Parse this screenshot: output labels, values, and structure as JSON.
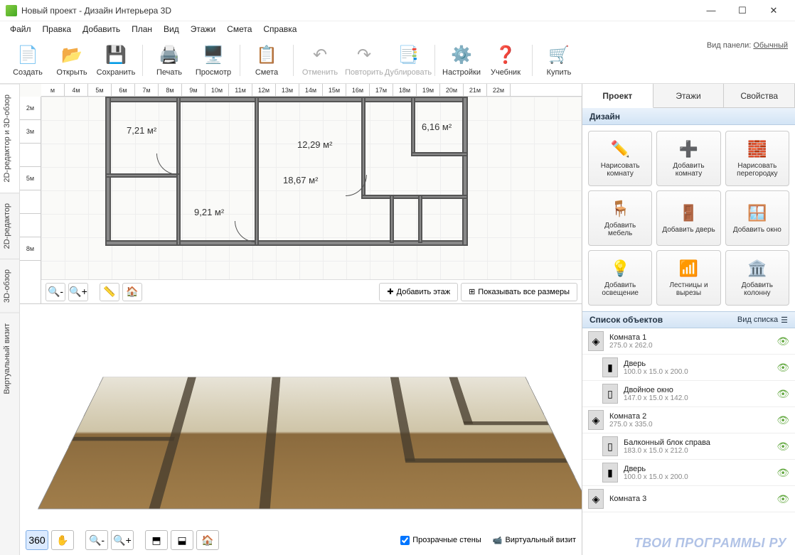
{
  "window": {
    "title": "Новый проект - Дизайн Интерьера 3D"
  },
  "menu": [
    "Файл",
    "Правка",
    "Добавить",
    "План",
    "Вид",
    "Этажи",
    "Смета",
    "Справка"
  ],
  "toolbar": {
    "create": "Создать",
    "open": "Открыть",
    "save": "Сохранить",
    "print": "Печать",
    "preview": "Просмотр",
    "estimate": "Смета",
    "undo": "Отменить",
    "redo": "Повторить",
    "duplicate": "Дублировать",
    "settings": "Настройки",
    "tutorial": "Учебник",
    "buy": "Купить",
    "panel_label": "Вид панели:",
    "panel_mode": "Обычный"
  },
  "side_tabs": {
    "t1": "2D-редактор и 3D-обзор",
    "t2": "2D-редактор",
    "t3": "3D-обзор",
    "t4": "Виртуальный визит"
  },
  "ruler_h": [
    "м",
    "4м",
    "5м",
    "6м",
    "7м",
    "8м",
    "9м",
    "10м",
    "11м",
    "12м",
    "13м",
    "14м",
    "15м",
    "16м",
    "17м",
    "18м",
    "19м",
    "20м",
    "21м",
    "22м"
  ],
  "ruler_v": [
    "2м",
    "3м",
    "",
    "5м",
    "",
    "",
    "8м"
  ],
  "rooms": {
    "r1": "7,21 м²",
    "r2": "18,67 м²",
    "r3": "12,29 м²",
    "r4": "6,16 м²",
    "r5": "9,21 м²"
  },
  "plan_actions": {
    "add_floor": "Добавить этаж",
    "show_dims": "Показывать все размеры"
  },
  "view3d": {
    "transparent": "Прозрачные стены",
    "record": "Виртуальный визит"
  },
  "right": {
    "tabs": {
      "project": "Проект",
      "floors": "Этажи",
      "props": "Свойства"
    },
    "design_hdr": "Дизайн",
    "buttons": {
      "b1": "Нарисовать комнату",
      "b2": "Добавить комнату",
      "b3": "Нарисовать перегородку",
      "b4": "Добавить мебель",
      "b5": "Добавить дверь",
      "b6": "Добавить окно",
      "b7": "Добавить освещение",
      "b8": "Лестницы и вырезы",
      "b9": "Добавить колонну"
    },
    "list_hdr": "Список объектов",
    "view_mode": "Вид списка",
    "objects": [
      {
        "name": "Комната 1",
        "dim": "275.0 x 262.0",
        "indent": false,
        "icon": "◈"
      },
      {
        "name": "Дверь",
        "dim": "100.0 x 15.0 x 200.0",
        "indent": true,
        "icon": "▮"
      },
      {
        "name": "Двойное окно",
        "dim": "147.0 x 15.0 x 142.0",
        "indent": true,
        "icon": "▯"
      },
      {
        "name": "Комната 2",
        "dim": "275.0 x 335.0",
        "indent": false,
        "icon": "◈"
      },
      {
        "name": "Балконный блок справа",
        "dim": "183.0 x 15.0 x 212.0",
        "indent": true,
        "icon": "▯"
      },
      {
        "name": "Дверь",
        "dim": "100.0 x 15.0 x 200.0",
        "indent": true,
        "icon": "▮"
      },
      {
        "name": "Комната 3",
        "dim": "",
        "indent": false,
        "icon": "◈"
      }
    ]
  },
  "watermark": "ТВОИ ПРОГРАММЫ РУ"
}
